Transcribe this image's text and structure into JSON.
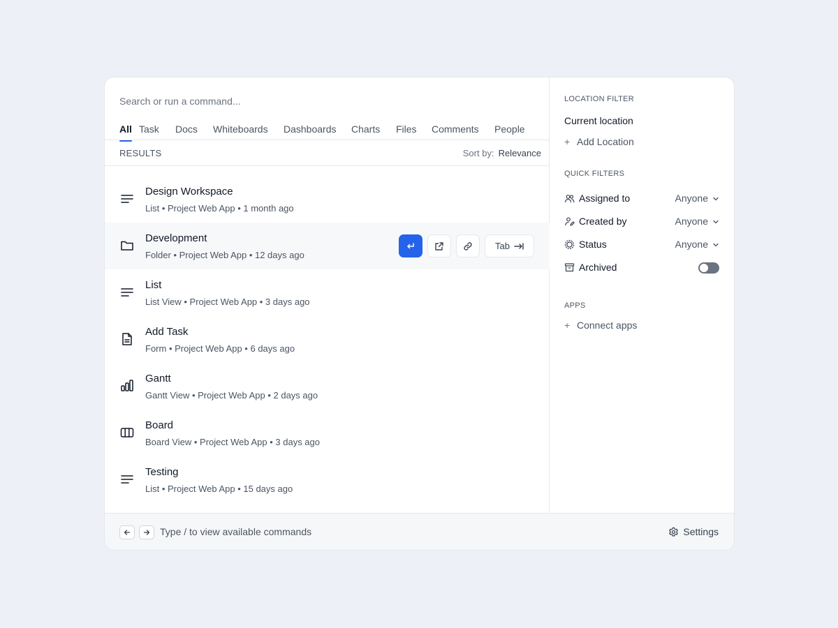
{
  "search": {
    "placeholder": "Search or run a command..."
  },
  "tabs": [
    "All",
    "Task",
    "Docs",
    "Whiteboards",
    "Dashboards",
    "Charts",
    "Files",
    "Comments",
    "People"
  ],
  "results": {
    "label": "RESULTS",
    "sort_label": "Sort by:",
    "sort_value": "Relevance",
    "items": [
      {
        "title": "Design Workspace",
        "meta": "List • Project Web App • 1 month ago",
        "icon": "list-icon"
      },
      {
        "title": "Development",
        "meta": "Folder • Project Web App • 12 days ago",
        "icon": "folder-icon"
      },
      {
        "title": "List",
        "meta": "List View • Project Web App • 3 days ago",
        "icon": "list-icon"
      },
      {
        "title": "Add Task",
        "meta": "Form • Project Web App • 6 days ago",
        "icon": "document-icon"
      },
      {
        "title": "Gantt",
        "meta": "Gantt View • Project Web App • 2 days ago",
        "icon": "bar-chart-icon"
      },
      {
        "title": "Board",
        "meta": "Board View • Project Web App • 3 days ago",
        "icon": "board-columns-icon"
      },
      {
        "title": "Testing",
        "meta": "List • Project Web App • 15 days ago",
        "icon": "list-icon"
      }
    ],
    "row_actions": {
      "tab_label": "Tab"
    }
  },
  "sidebar": {
    "location_title": "LOCATION FILTER",
    "current_location": "Current location",
    "add_location": "Add Location",
    "quick_title": "QUICK FILTERS",
    "filters": [
      {
        "label": "Assigned to",
        "value": "Anyone",
        "icon": "users-icon"
      },
      {
        "label": "Created by",
        "value": "Anyone",
        "icon": "user-edit-icon"
      },
      {
        "label": "Status",
        "value": "Anyone",
        "icon": "status-icon"
      },
      {
        "label": "Archived",
        "icon": "archive-icon",
        "toggle_on": false
      }
    ],
    "apps_title": "APPS",
    "connect_apps": "Connect apps"
  },
  "footer": {
    "hint": "Type /  to view available commands",
    "settings": "Settings"
  },
  "colors": {
    "accent": "#2563eb",
    "background": "#edf0f6",
    "toggle_off": "#6b7280"
  }
}
